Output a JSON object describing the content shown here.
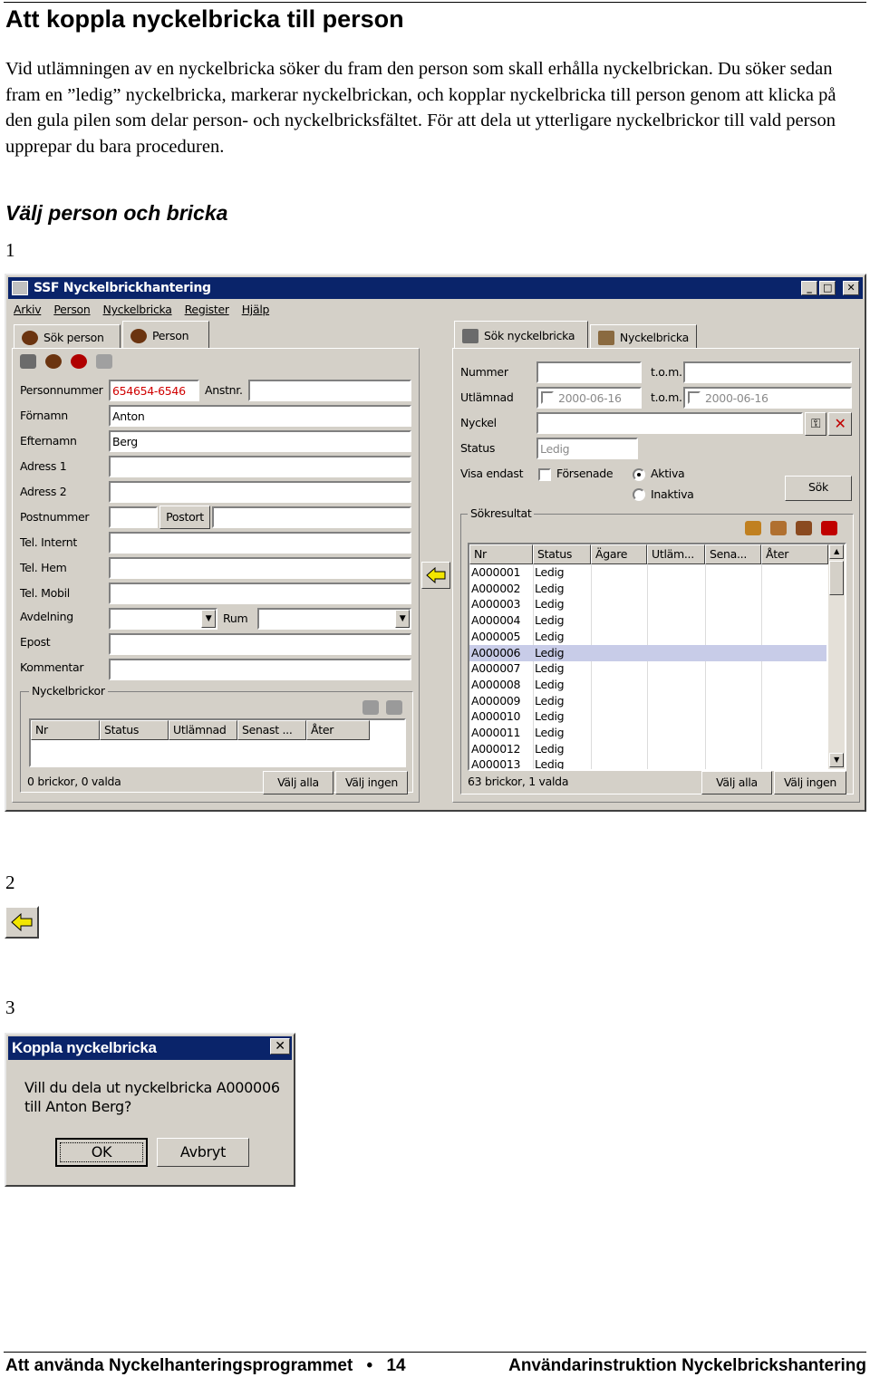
{
  "page": {
    "heading": "Att koppla nyckelbricka till person",
    "intro": "Vid utlämningen av en nyckelbricka söker du fram den person som skall erhålla nyckelbrickan. Du söker sedan fram en ”ledig” nyckelbricka, markerar nyckelbrickan, och kopplar  nyckelbricka till person genom att klicka på den gula pilen som delar person- och nyckelbricksfältet. För att dela ut ytterligare nyckelbrickor till vald person upprepar du bara proceduren.",
    "subheading": "Välj person och bricka",
    "steps": [
      "1",
      "2",
      "3"
    ]
  },
  "window": {
    "title": "SSF Nyckelbrickhantering",
    "menu": [
      "Arkiv",
      "Person",
      "Nyckelbricka",
      "Register",
      "Hjälp"
    ],
    "left_tabs": [
      "Sök person",
      "Person"
    ],
    "right_tabs": [
      "Sök nyckelbricka",
      "Nyckelbricka"
    ]
  },
  "person": {
    "labels": {
      "personnummer": "Personnummer",
      "anstnr": "Anstnr.",
      "fornamn": "Förnamn",
      "efternamn": "Efternamn",
      "adress1": "Adress 1",
      "adress2": "Adress 2",
      "postnummer": "Postnummer",
      "postort": "Postort",
      "tel_internt": "Tel. Internt",
      "tel_hem": "Tel. Hem",
      "tel_mobil": "Tel. Mobil",
      "avdelning": "Avdelning",
      "rum": "Rum",
      "epost": "Epost",
      "kommentar": "Kommentar"
    },
    "values": {
      "personnummer": "654654-6546",
      "fornamn": "Anton",
      "efternamn": "Berg"
    },
    "nyckelbrickor": {
      "group_title": "Nyckelbrickor",
      "columns": [
        "Nr",
        "Status",
        "Utlämnad",
        "Senast ...",
        "Åter"
      ],
      "status": "0 brickor, 0 valda",
      "select_all": "Välj alla",
      "select_none": "Välj ingen"
    }
  },
  "search": {
    "labels": {
      "nummer": "Nummer",
      "tom": "t.o.m.",
      "utlamnad": "Utlämnad",
      "nyckel": "Nyckel",
      "status": "Status",
      "visa_endast": "Visa endast",
      "forsenade": "Försenade",
      "aktiva": "Aktiva",
      "inaktiva": "Inaktiva",
      "sok": "Sök"
    },
    "utlamnad_from": "2000-06-16",
    "utlamnad_to": "2000-06-16",
    "status_value": "Ledig",
    "aktiva_selected": true,
    "results": {
      "group_title": "Sökresultat",
      "columns": [
        "Nr",
        "Status",
        "Ägare",
        "Utläm...",
        "Sena...",
        "Åter"
      ],
      "rows": [
        {
          "nr": "A000001",
          "status": "Ledig"
        },
        {
          "nr": "A000002",
          "status": "Ledig"
        },
        {
          "nr": "A000003",
          "status": "Ledig"
        },
        {
          "nr": "A000004",
          "status": "Ledig"
        },
        {
          "nr": "A000005",
          "status": "Ledig"
        },
        {
          "nr": "A000006",
          "status": "Ledig",
          "selected": true
        },
        {
          "nr": "A000007",
          "status": "Ledig"
        },
        {
          "nr": "A000008",
          "status": "Ledig"
        },
        {
          "nr": "A000009",
          "status": "Ledig"
        },
        {
          "nr": "A000010",
          "status": "Ledig"
        },
        {
          "nr": "A000011",
          "status": "Ledig"
        },
        {
          "nr": "A000012",
          "status": "Ledig"
        },
        {
          "nr": "A000013",
          "status": "Ledig"
        }
      ],
      "status": "63 brickor, 1 valda",
      "select_all": "Välj alla",
      "select_none": "Välj ingen"
    }
  },
  "dialog": {
    "title": "Koppla nyckelbricka",
    "message": "Vill du dela ut nyckelbricka A000006 till Anton Berg?",
    "ok": "OK",
    "cancel": "Avbryt"
  },
  "footer": {
    "left": "Att använda Nyckelhanteringsprogrammet",
    "page_number": "14",
    "right": "Användarinstruktion Nyckelbrickshantering"
  },
  "colors": {
    "titlebar": "#0a246a",
    "face": "#d4d0c8",
    "arrow": "#f2e600",
    "required_text": "#d00000"
  }
}
